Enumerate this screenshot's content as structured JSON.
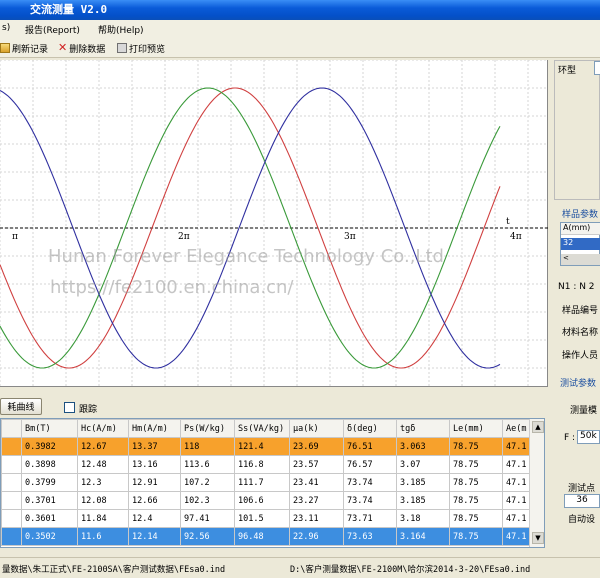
{
  "window": {
    "title": "交流测量 V2.0"
  },
  "menu": {
    "items": [
      "s)",
      "报告(Report)",
      "帮助(Help)"
    ]
  },
  "toolbar": {
    "refresh": "刷新记录",
    "delete": "删除数据",
    "print": "打印预览"
  },
  "chart_data": {
    "type": "line",
    "x_ticks": [
      "π",
      "2π",
      "3π",
      "4π"
    ],
    "axis_label_t": "t",
    "series": [
      {
        "color": "#d04040"
      },
      {
        "color": "#3a9a3a"
      },
      {
        "color": "#3030a0"
      }
    ]
  },
  "watermark": {
    "line1": "Hunan Forever Elegance Technology Co.,Ltd",
    "line2": "https://fe2100.en.china.cn/"
  },
  "right_panel": {
    "ring_label": "环型",
    "sample_params_label": "样品参数",
    "a_header": "A(mm)",
    "a_value": "32",
    "n_label": "N1 : N 2",
    "sample_no": "样品编号",
    "material": "材料名称",
    "operator": "操作人员",
    "test_params": "测试参数",
    "meas_mode": "测量模",
    "f_label": "F :",
    "f_value": "50k",
    "test_points": "测试点",
    "test_points_value": "36",
    "auto_set": "自动设"
  },
  "controls": {
    "loss_curve_btn": "耗曲线",
    "track_label": "跟踪"
  },
  "table": {
    "headers": [
      "",
      "Bm(T)",
      "Hc(A/m)",
      "Hm(A/m)",
      "Ps(W/kg)",
      "Ss(VA/kg)",
      "μa(k)",
      "δ(deg)",
      "tgδ",
      "Le(mm)",
      "Ae(m"
    ],
    "rows": [
      [
        "",
        "0.3982",
        "12.67",
        "13.37",
        "118",
        "121.4",
        "23.69",
        "76.51",
        "3.063",
        "78.75",
        "47.1"
      ],
      [
        "",
        "0.3898",
        "12.48",
        "13.16",
        "113.6",
        "116.8",
        "23.57",
        "76.57",
        "3.07",
        "78.75",
        "47.1"
      ],
      [
        "",
        "0.3799",
        "12.3",
        "12.91",
        "107.2",
        "111.7",
        "23.41",
        "73.74",
        "3.185",
        "78.75",
        "47.1"
      ],
      [
        "",
        "0.3701",
        "12.08",
        "12.66",
        "102.3",
        "106.6",
        "23.27",
        "73.74",
        "3.185",
        "78.75",
        "47.1"
      ],
      [
        "",
        "0.3601",
        "11.84",
        "12.4",
        "97.41",
        "101.5",
        "23.11",
        "73.71",
        "3.18",
        "78.75",
        "47.1"
      ],
      [
        "",
        "0.3502",
        "11.6",
        "12.14",
        "92.56",
        "96.48",
        "22.96",
        "73.63",
        "3.164",
        "78.75",
        "47.1"
      ]
    ]
  },
  "status": {
    "left": "量数据\\朱工正式\\FE-2100SA\\客户测试数据\\FEsa0.ind",
    "right": "D:\\客户测量数据\\FE-2100M\\哈尔滨2014-3-20\\FEsa0.ind"
  }
}
